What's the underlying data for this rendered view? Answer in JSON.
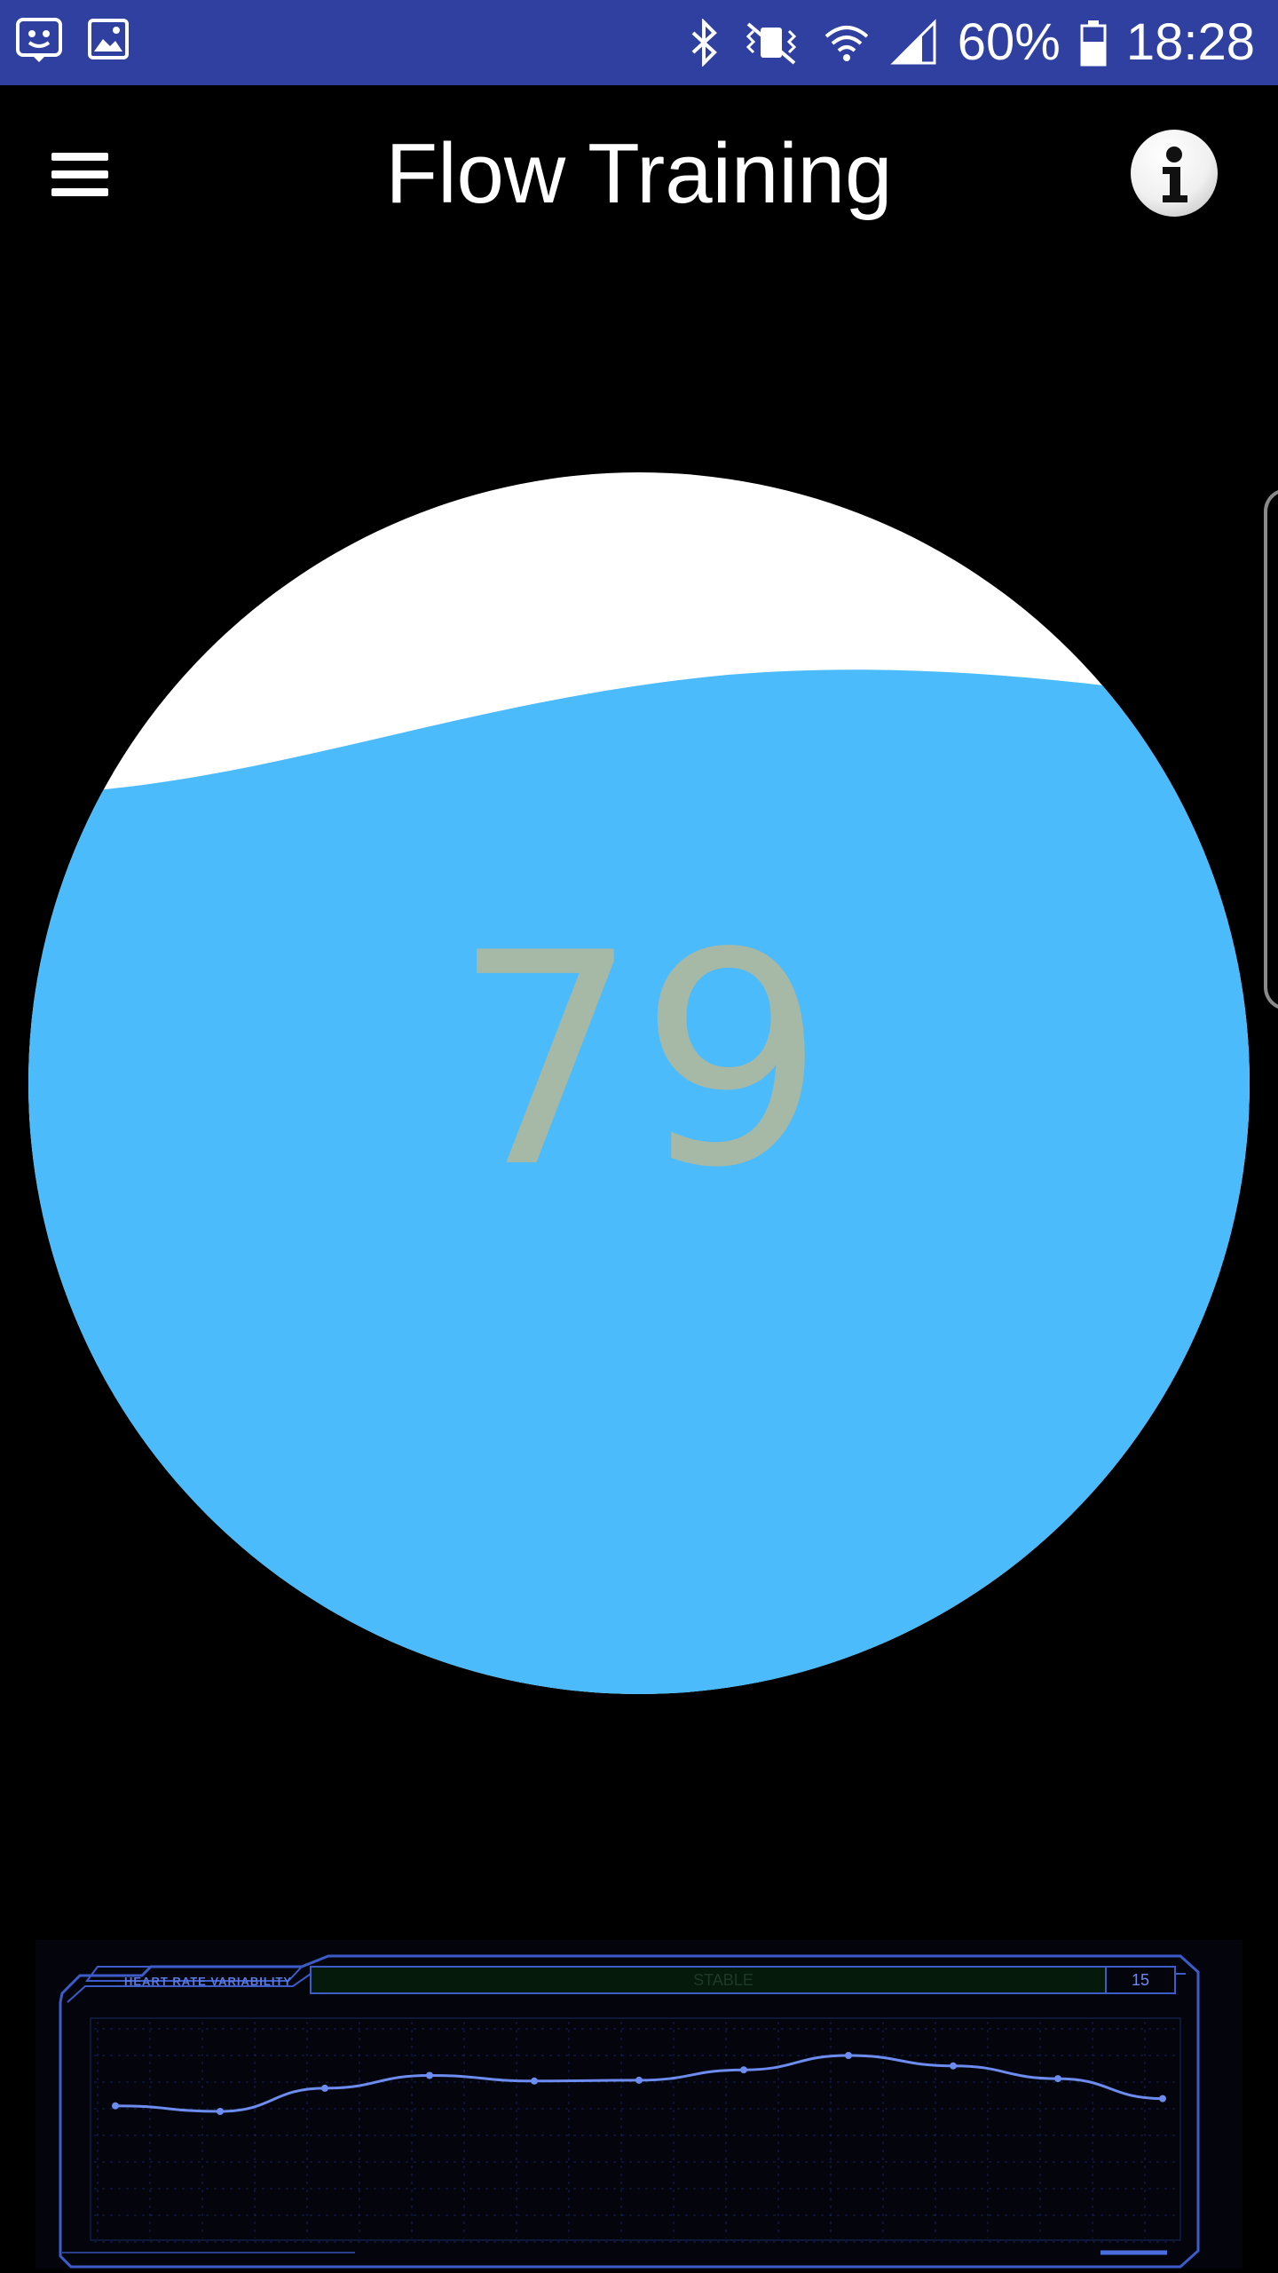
{
  "status_bar": {
    "left_icons": [
      "face-notification-icon",
      "gallery-notification-icon"
    ],
    "right_icons": [
      "bluetooth-icon",
      "mute-vibrate-icon",
      "wifi-icon",
      "signal-icon",
      "battery-icon"
    ],
    "battery": "60%",
    "time": "18:28",
    "background": "#2f40a0"
  },
  "app_bar": {
    "title": "Flow Training",
    "menu_icon": "hamburger-menu-icon",
    "info_icon": "info-icon"
  },
  "gauge": {
    "score": "79",
    "fill_color": "#4cbbfc",
    "empty_color": "#ffffff",
    "score_color": "#a6b8a6"
  },
  "hrv": {
    "label": "HEART RATE VARIABILITY",
    "status": "STABLE",
    "value": "15",
    "accent": "#5a7ae0",
    "chart_data": {
      "type": "line",
      "series_values": [
        0.37,
        0.3,
        0.59,
        0.75,
        0.68,
        0.69,
        0.82,
        1.0,
        0.87,
        0.71,
        0.46
      ],
      "grid": true
    }
  }
}
